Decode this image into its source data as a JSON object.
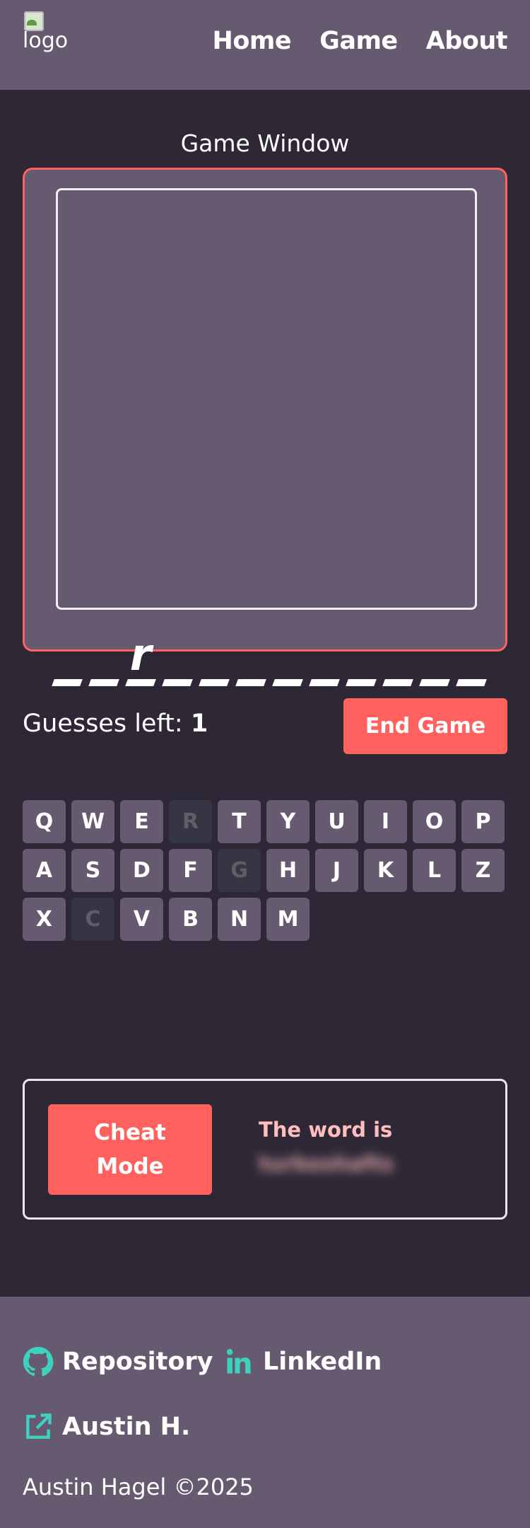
{
  "header": {
    "logo_alt": "logo",
    "nav": [
      "Home",
      "Game",
      "About"
    ]
  },
  "game": {
    "window_title": "Game Window",
    "word_slots": [
      "",
      "",
      "r",
      "",
      "",
      "",
      "",
      "",
      "",
      "",
      "",
      ""
    ],
    "guesses_label": "Guesses left: ",
    "guesses_left": "1",
    "end_button": "End Game"
  },
  "keyboard": {
    "rows": [
      [
        {
          "k": "Q",
          "used": false
        },
        {
          "k": "W",
          "used": false
        },
        {
          "k": "E",
          "used": false
        },
        {
          "k": "R",
          "used": true
        },
        {
          "k": "T",
          "used": false
        },
        {
          "k": "Y",
          "used": false
        },
        {
          "k": "U",
          "used": false
        },
        {
          "k": "I",
          "used": false
        },
        {
          "k": "O",
          "used": false
        },
        {
          "k": "P",
          "used": false
        }
      ],
      [
        {
          "k": "A",
          "used": false
        },
        {
          "k": "S",
          "used": false
        },
        {
          "k": "D",
          "used": false
        },
        {
          "k": "F",
          "used": false
        },
        {
          "k": "G",
          "used": true
        },
        {
          "k": "H",
          "used": false
        },
        {
          "k": "J",
          "used": false
        },
        {
          "k": "K",
          "used": false
        },
        {
          "k": "L",
          "used": false
        },
        {
          "k": "Z",
          "used": false
        }
      ],
      [
        {
          "k": "X",
          "used": false
        },
        {
          "k": "C",
          "used": true
        },
        {
          "k": "V",
          "used": false
        },
        {
          "k": "B",
          "used": false
        },
        {
          "k": "N",
          "used": false
        },
        {
          "k": "M",
          "used": false
        }
      ]
    ]
  },
  "cheat": {
    "button": "Cheat Mode",
    "label": "The word is",
    "word": "turboshafts"
  },
  "footer": {
    "repo": "Repository",
    "linkedin": "LinkedIn",
    "author": "Austin H.",
    "copyright": "Austin Hagel ©2025"
  },
  "colors": {
    "accent": "#ff625e",
    "panel": "#655a6f",
    "background": "#2e2836",
    "icon": "#3ed1c0"
  }
}
